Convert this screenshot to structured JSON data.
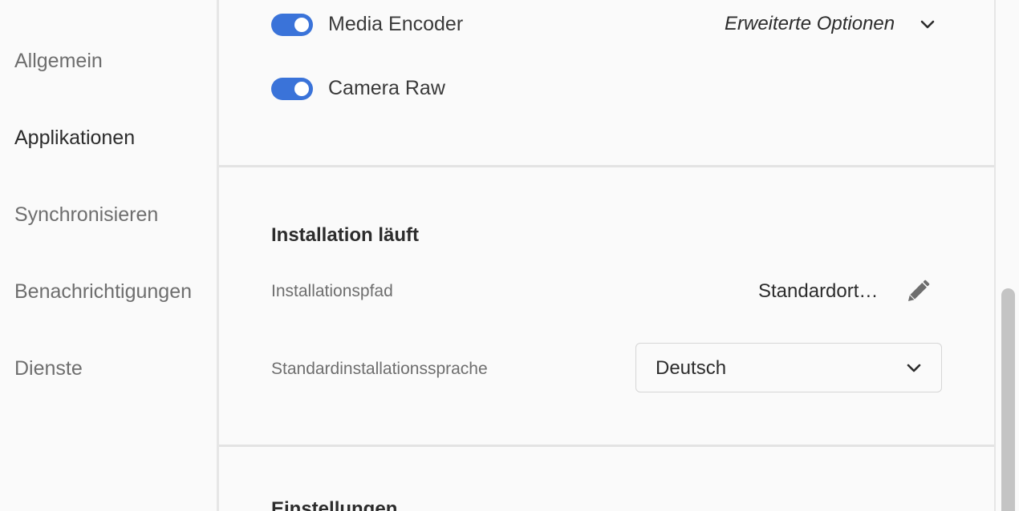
{
  "sidebar": {
    "items": [
      {
        "label": "Allgemein"
      },
      {
        "label": "Applikationen"
      },
      {
        "label": "Synchronisieren"
      },
      {
        "label": "Benachrichtigungen"
      },
      {
        "label": "Dienste"
      }
    ],
    "active": "Applikationen"
  },
  "apps": {
    "toggles": [
      {
        "label": "Media Encoder",
        "on": true
      },
      {
        "label": "Camera Raw",
        "on": true
      }
    ],
    "advanced_options": "Erweiterte Optionen"
  },
  "install": {
    "title": "Installation läuft",
    "path_label": "Installationspfad",
    "path_value": "Standardort…",
    "language_label": "Standardinstallationssprache",
    "language_value": "Deutsch"
  },
  "next_section": {
    "title": "Einstellungen"
  },
  "colors": {
    "accent": "#3a73d9",
    "divider": "#e3e3e3",
    "background": "#fafafa"
  },
  "icons": {
    "edit": "pencil-icon",
    "expand": "chevron-down-icon"
  }
}
